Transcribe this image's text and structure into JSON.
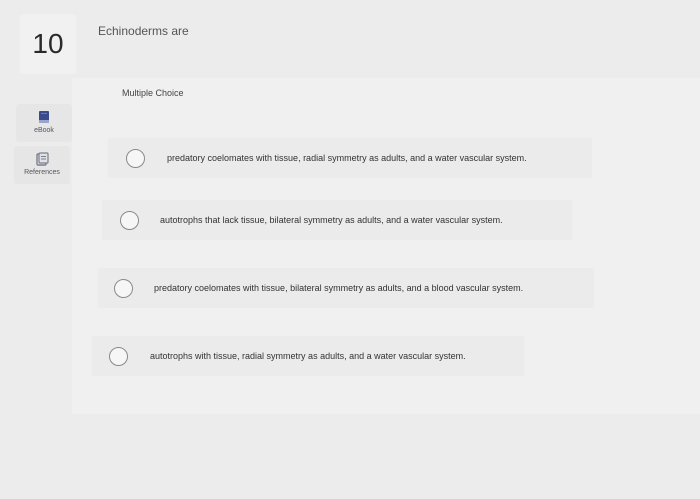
{
  "question": {
    "number": "10",
    "text": "Echinoderms are",
    "answer_type": "Multiple Choice"
  },
  "tools": {
    "ebook": {
      "label": "eBook",
      "icon": "book-icon",
      "color": "#3b4a8c"
    },
    "references": {
      "label": "References",
      "icon": "references-icon",
      "color": "#7a7f8c"
    }
  },
  "choices": [
    {
      "text": "predatory coelomates with tissue, radial symmetry as adults, and a water vascular system.",
      "selected": false
    },
    {
      "text": "autotrophs that lack tissue, bilateral symmetry as adults, and a water vascular system.",
      "selected": false
    },
    {
      "text": "predatory coelomates with tissue, bilateral symmetry as adults, and a blood vascular system.",
      "selected": false
    },
    {
      "text": "autotrophs with tissue, radial symmetry as adults, and a water vascular system.",
      "selected": false
    }
  ]
}
